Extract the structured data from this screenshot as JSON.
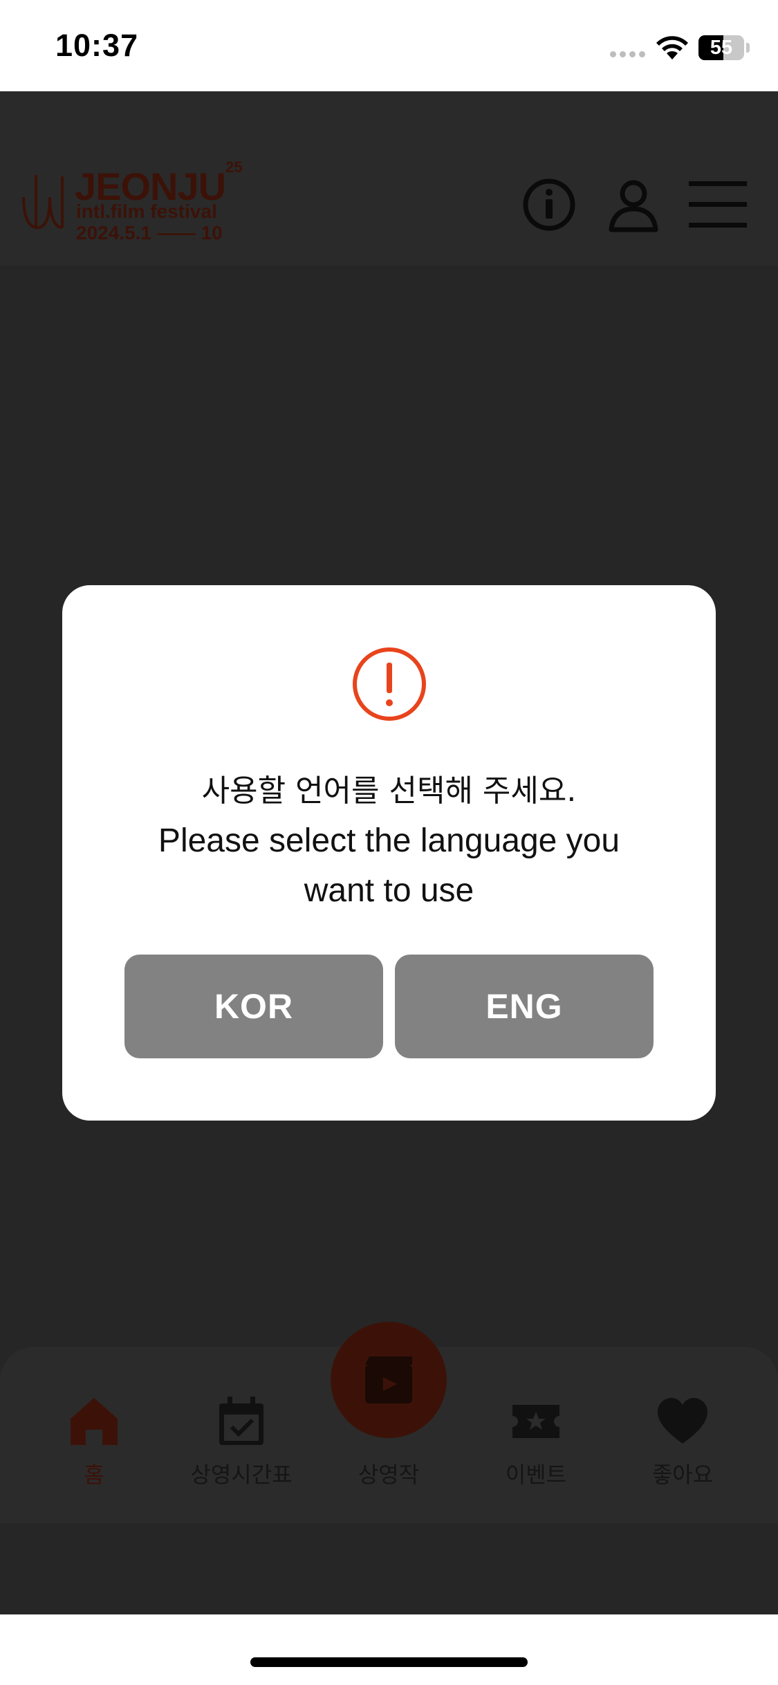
{
  "status_bar": {
    "time": "10:37",
    "battery": "55"
  },
  "header": {
    "logo": {
      "title": "JEONJU",
      "edition": "25",
      "subtitle": "intl.film festival",
      "dates": "2024.5.1 —— 10"
    },
    "icons": [
      "info-icon",
      "user-icon",
      "menu-icon"
    ]
  },
  "dialog": {
    "message_ko": "사용할 언어를 선택해 주세요.",
    "message_en_line1": "Please select the language you",
    "message_en_line2": "want to use",
    "buttons": {
      "kor": "KOR",
      "eng": "ENG"
    },
    "colors": {
      "alert": "#e8441c",
      "button_bg": "#828282"
    }
  },
  "bottom_nav": {
    "items": [
      {
        "label": "홈",
        "icon": "home-icon",
        "active": true
      },
      {
        "label": "상영시간표",
        "icon": "calendar-check-icon"
      },
      {
        "label": "상영작",
        "icon": "film-clapper-icon"
      },
      {
        "label": "이벤트",
        "icon": "ticket-star-icon"
      },
      {
        "label": "좋아요",
        "icon": "heart-icon"
      }
    ]
  },
  "colors": {
    "overlay_bg": "#262626",
    "brand_dim": "#3c1208"
  }
}
